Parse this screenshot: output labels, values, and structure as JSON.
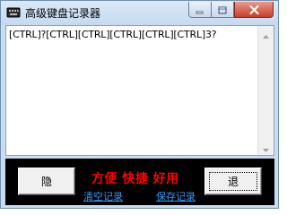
{
  "window": {
    "title": "高级键盘记录器"
  },
  "log": {
    "text": "[CTRL]?[CTRL][CTRL][CTRL][CTRL][CTRL]3?"
  },
  "controls": {
    "hide_label": "隐",
    "exit_label": "退",
    "slogan": "方便 快捷 好用",
    "clear_link": "清空记录",
    "save_link": "保存记录"
  },
  "icons": {
    "app": "keyboard-app-icon",
    "minimize": "minimize-icon",
    "maximize": "maximize-icon",
    "close": "close-icon",
    "scroll_up": "scroll-up-arrow-icon",
    "scroll_down": "scroll-down-arrow-icon"
  },
  "colors": {
    "slogan": "#ff0000",
    "link": "#3399ff",
    "panel": "#000000",
    "close_button": "#c7402c"
  }
}
